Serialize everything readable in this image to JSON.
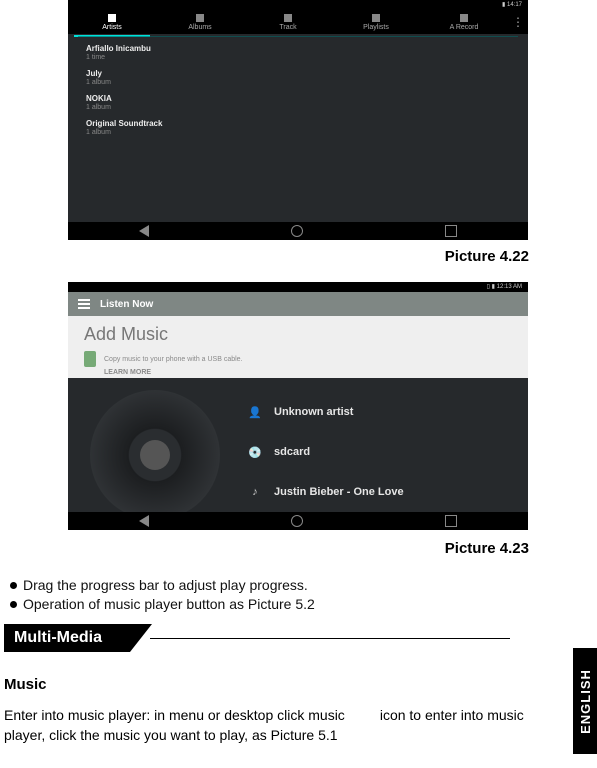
{
  "shot1": {
    "status_time": "14:17",
    "tabs": [
      "Artists",
      "Albums",
      "Track",
      "Playlists",
      "A Record"
    ],
    "artists": [
      {
        "name": "Arfiallo Inicambu",
        "sub": "1 time"
      },
      {
        "name": "July",
        "sub": "1 album"
      },
      {
        "name": "NOKIA",
        "sub": "1 album"
      },
      {
        "name": "Original Soundtrack",
        "sub": "1 album"
      }
    ]
  },
  "caption1": "Picture 4.22",
  "shot2": {
    "status_time": "12:13 AM",
    "header": "Listen Now",
    "add_title": "Add Music",
    "add_msg": "Copy music to your phone with a USB cable.",
    "learn": "LEARN MORE",
    "tracks": [
      {
        "icon": "person-icon",
        "glyph": "👤",
        "label": "Unknown artist"
      },
      {
        "icon": "album-icon",
        "glyph": "💿",
        "label": "sdcard"
      },
      {
        "icon": "note-icon",
        "glyph": "♪",
        "label": "Justin Bieber - One Love"
      }
    ]
  },
  "caption2": "Picture 4.23",
  "bullet1": "Drag the progress bar to adjust play progress.",
  "bullet2": "Operation of music player button as Picture 5.2",
  "section": "Multi-Media",
  "subhead": "Music",
  "para_a": "Enter into music player: in menu or desktop click music",
  "para_b": "icon to enter into music player, click the music you want to play, as Picture 5.1",
  "side": "ENGLISH"
}
